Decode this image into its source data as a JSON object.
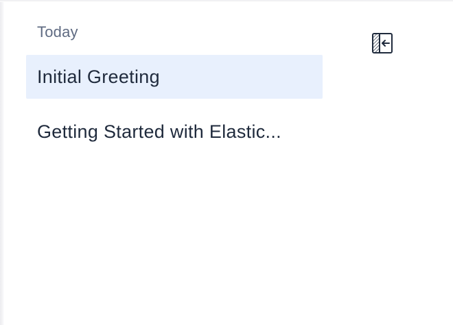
{
  "sidebar": {
    "section_label": "Today",
    "items": [
      {
        "label": "Initial Greeting",
        "active": true
      },
      {
        "label": "Getting Started with Elastic...",
        "active": false
      }
    ],
    "collapse_icon": "sidebar-collapse-icon"
  },
  "colors": {
    "active_bg": "#e8f0fd",
    "text": "#1f2a3c",
    "muted": "#5f6b82"
  }
}
